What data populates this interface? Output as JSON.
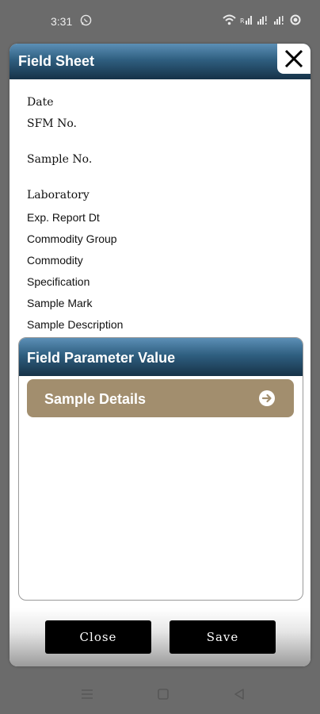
{
  "status_bar": {
    "time": "3:31",
    "icons": [
      "whatsapp-icon",
      "wifi-icon",
      "signal-icon",
      "signal-icon",
      "signal-icon",
      "battery-icon"
    ]
  },
  "dialog": {
    "title": "Field Sheet",
    "close_icon": "close-x-icon",
    "fields": [
      {
        "label": "Date"
      },
      {
        "label": "SFM No."
      },
      {
        "label": "Sample No."
      },
      {
        "label": "Laboratory"
      },
      {
        "label": "Exp. Report Dt"
      },
      {
        "label": "Commodity Group"
      },
      {
        "label": "Commodity"
      },
      {
        "label": "Specification"
      },
      {
        "label": "Sample Mark"
      },
      {
        "label": "Sample Description"
      }
    ],
    "parameter_panel": {
      "title": "Field Parameter Value",
      "item_label": "Sample Details",
      "item_icon": "arrow-right-circle-icon",
      "item_color": "#a28e6e"
    },
    "buttons": {
      "close_label": "Close",
      "save_label": "Save"
    }
  },
  "colors": {
    "header_gradient_top": "#5c8fb6",
    "header_gradient_bottom": "#163248",
    "button_bg": "#000000"
  },
  "nav_bar": {
    "icons": [
      "menu-icon",
      "home-icon",
      "back-icon"
    ]
  }
}
